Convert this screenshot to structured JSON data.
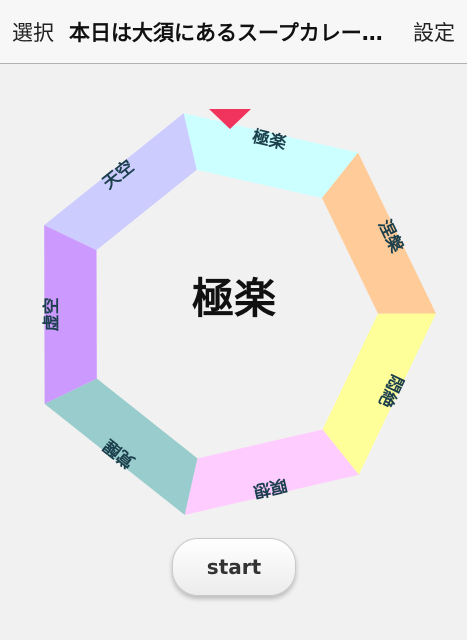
{
  "navbar": {
    "left_label": "選択",
    "title": "本日は大須にあるスープカレー屋さんを",
    "right_label": "設定"
  },
  "wheel": {
    "selected": "極楽",
    "pointer_color": "#f0345e",
    "segments": [
      {
        "label": "極楽",
        "color": "#ccffff"
      },
      {
        "label": "涅槃",
        "color": "#ffcc99"
      },
      {
        "label": "悶絶",
        "color": "#ffff99"
      },
      {
        "label": "瞑想",
        "color": "#ffccff"
      },
      {
        "label": "覚醒",
        "color": "#99cccc"
      },
      {
        "label": "虚空",
        "color": "#cc99ff"
      },
      {
        "label": "天空",
        "color": "#ccccff"
      }
    ]
  },
  "start_button": {
    "label": "start"
  }
}
